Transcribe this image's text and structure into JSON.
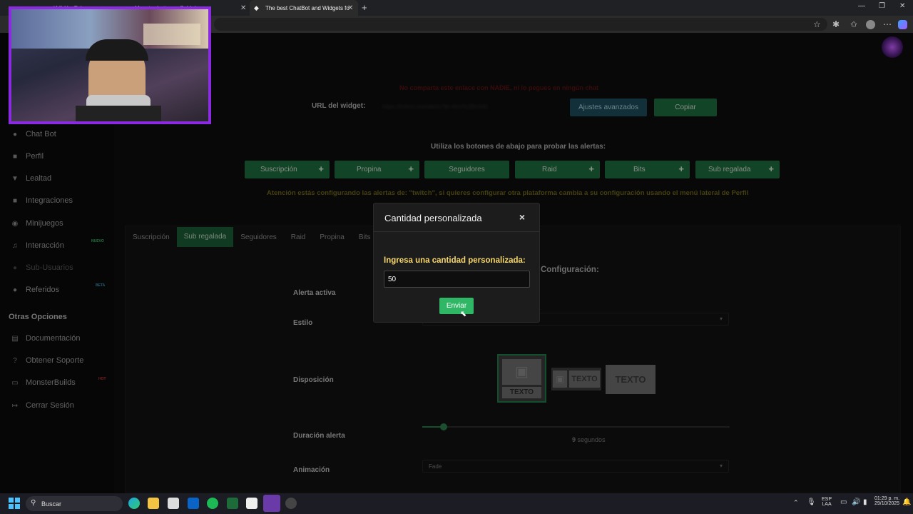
{
  "browser": {
    "tabs": [
      {
        "title": "(44) YouTube"
      },
      {
        "title": "Monster Lottery - Coldplay"
      },
      {
        "title": "The best ChatBot and Widgets fo"
      }
    ],
    "new_tab": "+"
  },
  "sidebar": {
    "items": [
      {
        "label": "Chat Bot",
        "icon": "robot-icon"
      },
      {
        "label": "Perfil",
        "icon": "user-icon"
      },
      {
        "label": "Lealtad",
        "icon": "trophy-icon"
      },
      {
        "label": "Integraciones",
        "icon": "plug-icon"
      },
      {
        "label": "Minijuegos",
        "icon": "gamepad-icon",
        "badge": "NUEVO"
      },
      {
        "label": "Interacción",
        "icon": "music-icon"
      },
      {
        "label": "Sub-Usuarios",
        "icon": "users-icon"
      },
      {
        "label": "Referidos",
        "icon": "people-icon",
        "badge": "BETA"
      }
    ],
    "section_title": "Otras Opciones",
    "other_items": [
      {
        "label": "Documentación",
        "icon": "book-icon"
      },
      {
        "label": "Obtener Soporte",
        "icon": "help-icon"
      },
      {
        "label": "MonsterBuilds",
        "icon": "monitor-icon",
        "badge": "HOT"
      },
      {
        "label": "Cerrar Sesión",
        "icon": "logout-icon"
      }
    ]
  },
  "main": {
    "warning": "No comparta este enlace con NADIE, ni lo pegues en ningún chat",
    "url_label": "URL del widget:",
    "url_value": "https://botmo.live/alerts?tk=4mv%2Bmhfd",
    "advanced_button": "Ajustes avanzados",
    "copy_button": "Copiar",
    "test_hint": "Utiliza los botones de abajo para probar las alertas:",
    "test_buttons": [
      "Suscripción",
      "Propina",
      "Seguidores",
      "Raid",
      "Bits",
      "Sub regalada"
    ],
    "platform_notice": "Atención estás configurando las alertas de: \"twitch\", si quieres configurar otra plataforma cambia a su configuración usando el menú lateral de Perfil",
    "alert_tabs": [
      "Suscripción",
      "Sub regalada",
      "Seguidores",
      "Raid",
      "Propina",
      "Bits"
    ],
    "active_tab": "Sub regalada",
    "config_title": "Configuración:",
    "alert_active_label": "Alerta activa",
    "style_label": "Estilo",
    "layout_label": "Disposición",
    "layout_text": "TEXTO",
    "duration_label": "Duración alerta",
    "duration_value": "9",
    "duration_unit": "segundos",
    "duration_fraction": 0.07,
    "animation_label": "Animación",
    "animation_value": "Fade"
  },
  "modal": {
    "title": "Cantidad personalizada",
    "close": "×",
    "label": "Ingresa una cantidad personalizada:",
    "input_value": "50",
    "submit": "Enviar"
  },
  "taskbar": {
    "search_placeholder": "Buscar",
    "lang_top": "ESP",
    "lang_bottom": "LAA",
    "time": "01:29 p. m.",
    "date": "29/10/2025"
  },
  "colors": {
    "accent_green": "#2fb765",
    "warning_red": "#c0392b",
    "notice_yellow": "#d4c24a",
    "webcam_border": "#8a2be2"
  }
}
